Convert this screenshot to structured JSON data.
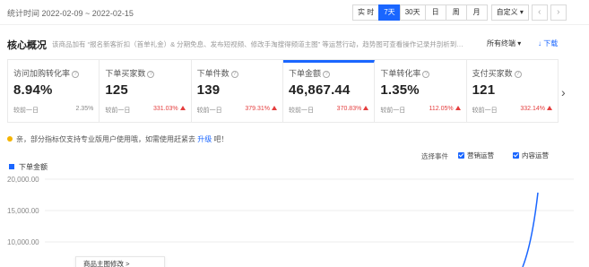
{
  "header": {
    "stat_time": "统计时间 2022-02-09 ~ 2022-02-15",
    "ranges": [
      {
        "label": "实 时",
        "active": false
      },
      {
        "label": "7天",
        "active": true
      },
      {
        "label": "30天",
        "active": false
      },
      {
        "label": "日",
        "active": false
      },
      {
        "label": "周",
        "active": false
      },
      {
        "label": "月",
        "active": false
      }
    ],
    "custom_label": "自定义",
    "prev_icon": "‹",
    "next_icon": "›"
  },
  "overview": {
    "title": "核心概况",
    "description": "该商品加有 “报名新客折扣（首单礼金）& 分期免息、发布短视频、修改手淘搜得频道主图” 等运营行动，趋势图可查看操作记录并剖析到…",
    "channel_label": "所有终端",
    "download_label": "↓ 下载"
  },
  "metrics": [
    {
      "label": "访问加购转化率",
      "value": "8.94%",
      "compare": "较前一日",
      "delta": "2.35%",
      "trend": "flat",
      "selected": false
    },
    {
      "label": "下单买家数",
      "value": "125",
      "compare": "较前一日",
      "delta": "331.03%",
      "trend": "up",
      "selected": false
    },
    {
      "label": "下单件数",
      "value": "139",
      "compare": "较前一日",
      "delta": "379.31%",
      "trend": "up",
      "selected": false
    },
    {
      "label": "下单金额",
      "value": "46,867.44",
      "compare": "较前一日",
      "delta": "370.83%",
      "trend": "up",
      "selected": true
    },
    {
      "label": "下单转化率",
      "value": "1.35%",
      "compare": "较前一日",
      "delta": "112.05%",
      "trend": "up",
      "selected": false
    },
    {
      "label": "支付买家数",
      "value": "121",
      "compare": "较前一日",
      "delta": "332.14%",
      "trend": "up",
      "selected": false
    }
  ],
  "notice": {
    "text": "亲，部分指标仅支持专业版用户使用哦，如需使用赶紧去",
    "link": "升级",
    "suffix": "吧！"
  },
  "chart_controls": {
    "event_label": "选择事件",
    "checkbox_1": "营销运营",
    "checkbox_2": "内容运营"
  },
  "colors": {
    "accent": "#1a66ff",
    "up": "#e43e3e",
    "notice": "#f5b400"
  },
  "chart_data": {
    "type": "line",
    "series": [
      {
        "name": "下单金额"
      }
    ],
    "y_ticks": [
      "20,000.00",
      "15,000.00",
      "10,000.00"
    ],
    "ylim": [
      5000,
      20000
    ],
    "grid": true
  },
  "tooltip": {
    "label": "商品主图修改 >"
  }
}
